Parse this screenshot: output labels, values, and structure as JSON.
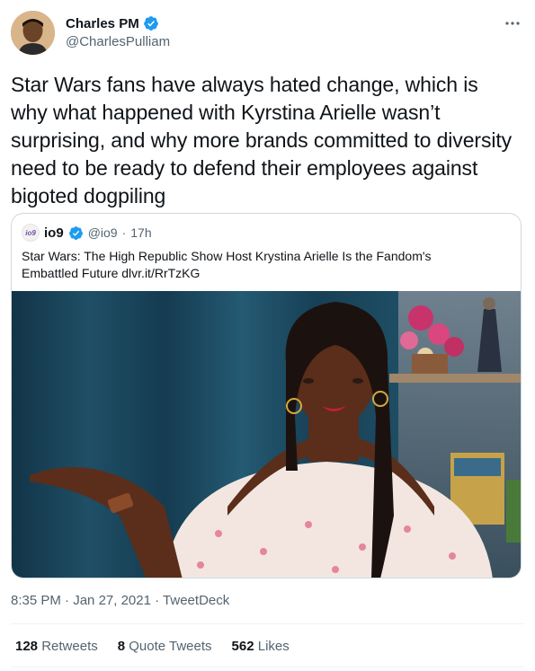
{
  "author": {
    "name": "Charles PM",
    "handle": "@CharlesPulliam"
  },
  "tweet": {
    "text": "Star Wars fans have always hated change, which is why what happened with Kyrstina Arielle wasn’t surprising, and why more brands committed to diversity need to be ready to defend their employees against bigoted dogpiling"
  },
  "quote": {
    "avatar_text": "io9",
    "name": "io9",
    "handle": "@io9",
    "separator": "·",
    "time": "17h",
    "text": "Star Wars: The High Republic Show Host Krystina Arielle Is the Fandom's Embattled Future dlvr.it/RrTzKG"
  },
  "meta": {
    "time": "8:35 PM",
    "sep1": "·",
    "date": "Jan 27, 2021",
    "sep2": "·",
    "source": "TweetDeck"
  },
  "stats": {
    "retweets_count": "128",
    "retweets_label": "Retweets",
    "quotes_count": "8",
    "quotes_label": "Quote Tweets",
    "likes_count": "562",
    "likes_label": "Likes"
  },
  "colors": {
    "accent": "#1d9bf0",
    "text": "#0f1419",
    "secondary": "#536471",
    "border": "#cfd9de"
  },
  "icons": {
    "verified": "verified-badge-icon",
    "more": "more-horizontal-icon"
  }
}
